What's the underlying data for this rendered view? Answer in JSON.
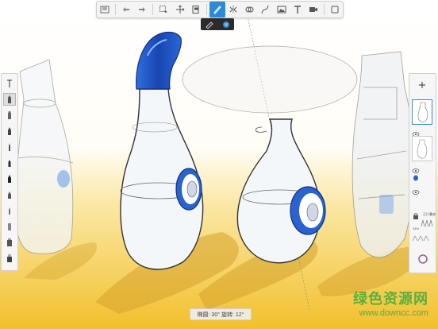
{
  "toolbar": {
    "tools": [
      "layers-icon",
      "undo-icon",
      "redo-icon",
      "select-icon",
      "transform-icon",
      "copy-icon",
      "brush-icon",
      "symmetry-icon",
      "ruler-icon",
      "curve-icon",
      "image-icon",
      "text-icon",
      "video-icon",
      "fullscreen-icon"
    ],
    "active": "brush-icon"
  },
  "subbar": {
    "tools": [
      "eraser-icon",
      "blend-icon"
    ],
    "active": "blend-icon"
  },
  "left_panel": {
    "brushes": [
      "brush-ballpoint",
      "brush-pencil",
      "brush-marker",
      "brush-airbrush",
      "brush-paint",
      "brush-fineliner",
      "brush-calligraphy",
      "brush-felt",
      "brush-ink",
      "brush-chisel",
      "brush-smudge",
      "brush-fill"
    ],
    "selected_index": 1
  },
  "right_panel": {
    "layer_count": 3,
    "selected_layer": 0,
    "layer_label": "正片叠底",
    "opacity_label": "34%"
  },
  "status": {
    "text": "椭圆: 30° 旋转: 12°"
  },
  "watermark": {
    "title": "绿色资源网",
    "url": "www.downcc.com"
  },
  "colors": {
    "accent": "#2b8bd6",
    "bottle_blue": "#1f5fc9",
    "bg_yellow": "#f5c431"
  }
}
